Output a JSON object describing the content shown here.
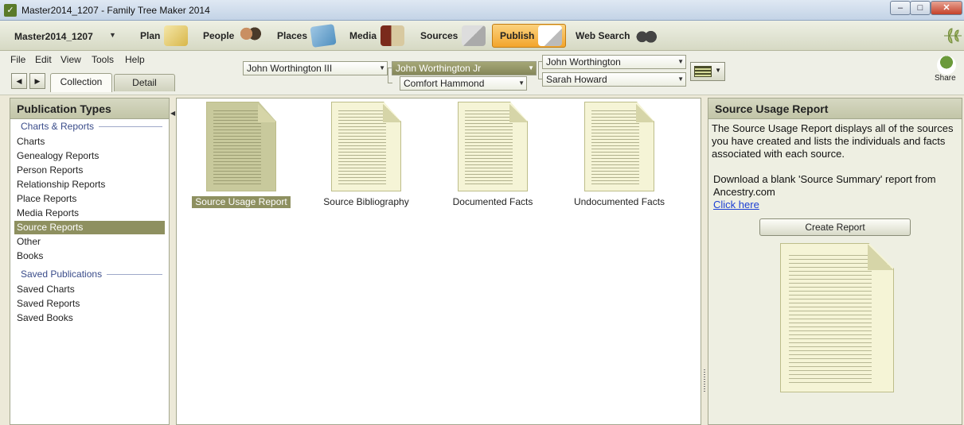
{
  "window": {
    "title": "Master2014_1207 - Family Tree Maker 2014",
    "min_label": "–",
    "max_label": "□",
    "close_label": "✕",
    "app_icon": "✓"
  },
  "toolbar": {
    "tree_name": "Master2014_1207",
    "tree_dropdown": "▼",
    "nav": [
      {
        "label": "Plan",
        "icon": "plan-icon"
      },
      {
        "label": "People",
        "icon": "people-icon"
      },
      {
        "label": "Places",
        "icon": "places-icon"
      },
      {
        "label": "Media",
        "icon": "media-icon"
      },
      {
        "label": "Sources",
        "icon": "sources-icon"
      },
      {
        "label": "Publish",
        "icon": "publish-icon"
      },
      {
        "label": "Web Search",
        "icon": "binoculars-icon"
      }
    ]
  },
  "menu": {
    "items": [
      "File",
      "Edit",
      "View",
      "Tools",
      "Help"
    ],
    "back": "◀",
    "forward": "▶",
    "tabs": [
      "Collection",
      "Detail"
    ]
  },
  "family": {
    "child": "John Worthington III",
    "focus": "John Worthington Jr",
    "spouse": "Comfort Hammond",
    "father": "John Worthington",
    "mother": "Sarah Howard",
    "dropdown": "▼"
  },
  "share": {
    "label": "Share"
  },
  "left_panel": {
    "header": "Publication Types",
    "section_charts": "Charts & Reports",
    "items": [
      "Charts",
      "Genealogy Reports",
      "Person Reports",
      "Relationship Reports",
      "Place Reports",
      "Media Reports",
      "Source Reports",
      "Other",
      "Books"
    ],
    "selected_index": 6,
    "section_saved": "Saved Publications",
    "saved_items": [
      "Saved Charts",
      "Saved Reports",
      "Saved Books"
    ],
    "collapse_arrow": "◀"
  },
  "center": {
    "reports": [
      "Source Usage Report",
      "Source Bibliography",
      "Documented Facts",
      "Undocumented Facts"
    ],
    "selected_index": 0
  },
  "right_panel": {
    "header": "Source Usage Report",
    "description": "The Source Usage Report displays all of the sources you have created and lists the individuals and facts associated with each source.",
    "download_text": "Download a blank 'Source Summary' report from Ancestry.com",
    "link": "Click here",
    "button": "Create Report"
  }
}
